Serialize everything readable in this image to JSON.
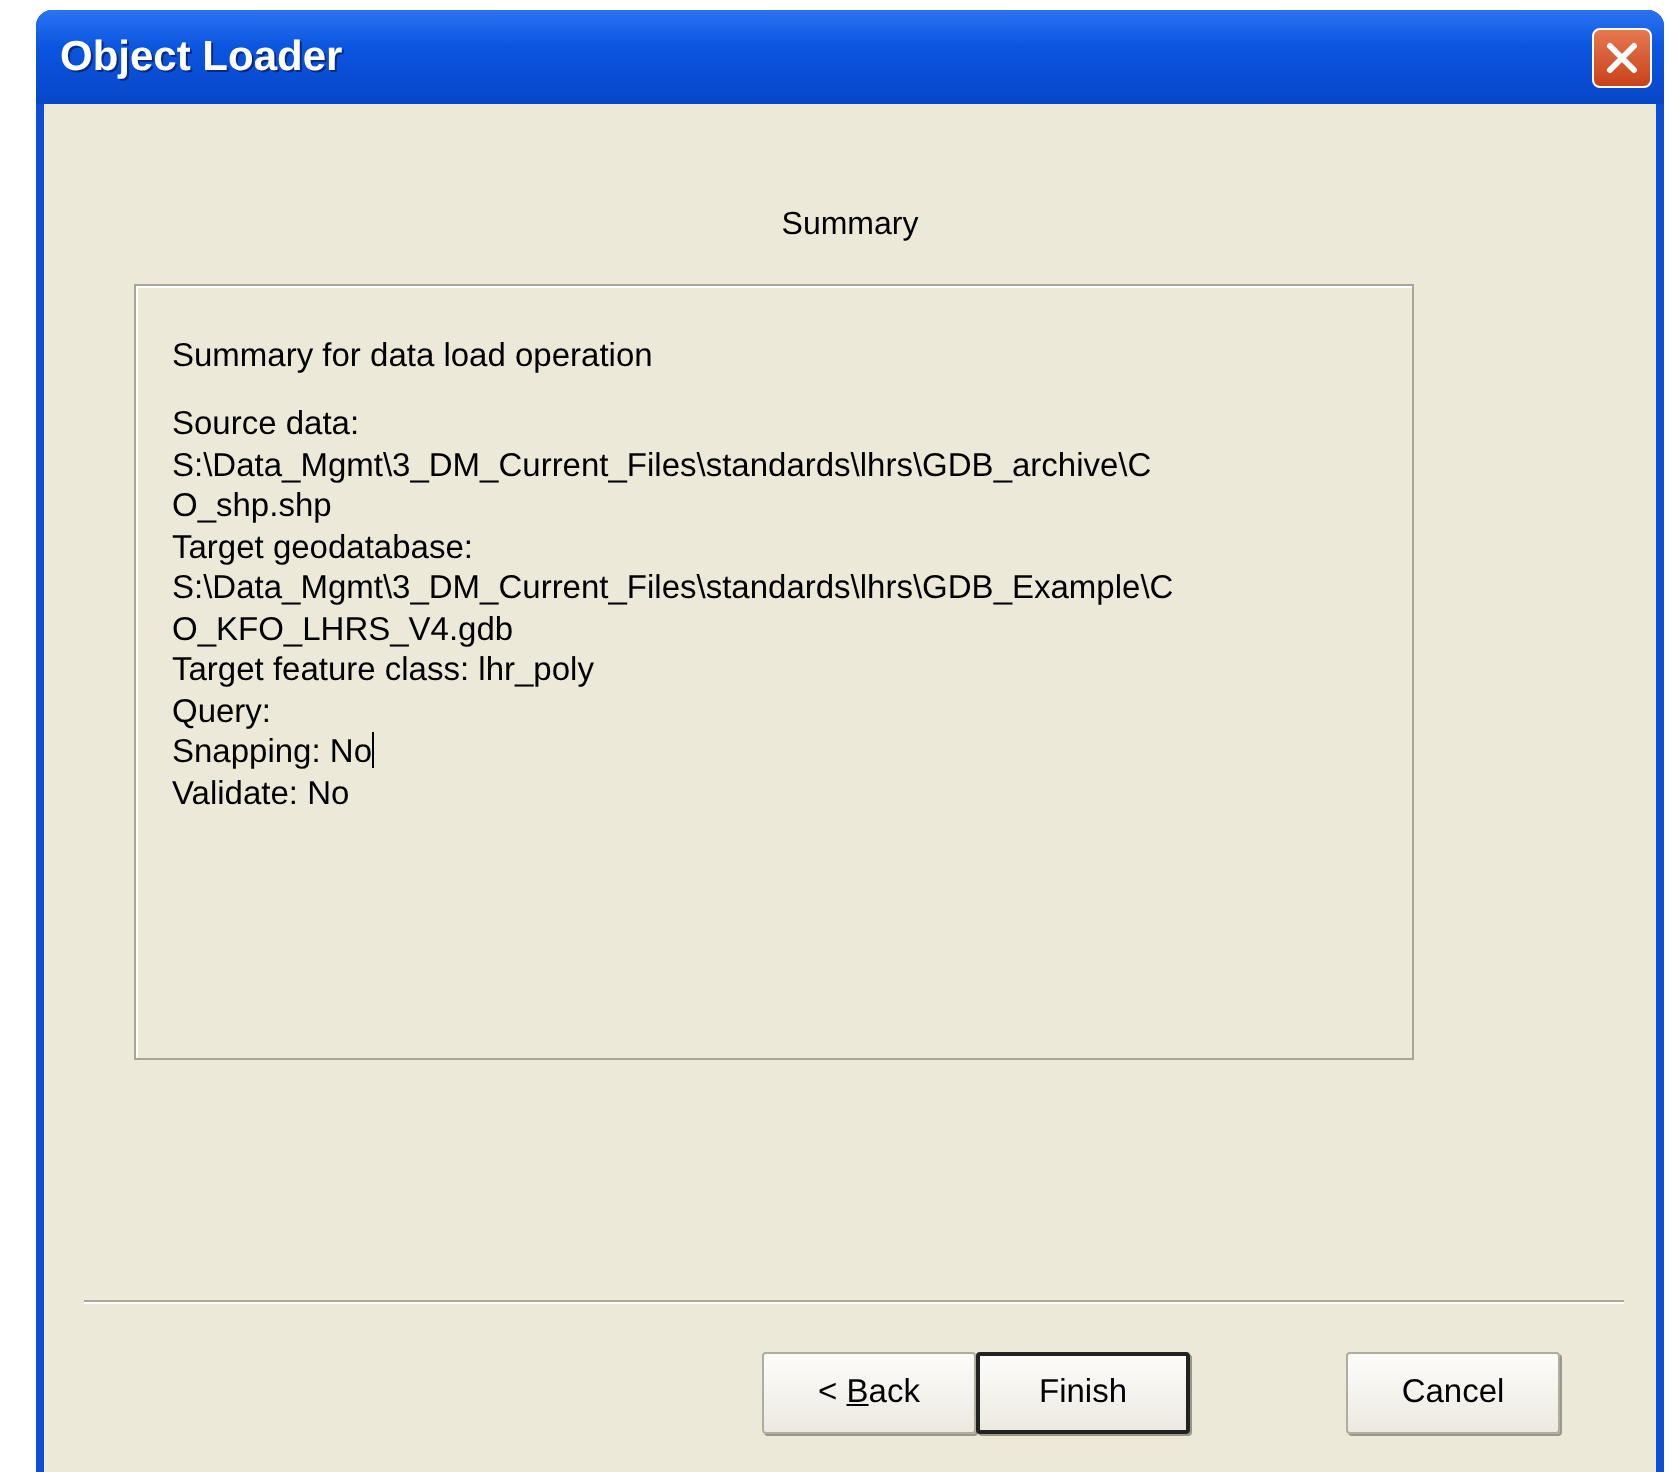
{
  "window": {
    "title": "Object Loader"
  },
  "heading": "Summary",
  "summary": {
    "title": "Summary for data load operation",
    "lines": [
      {
        "text": "Source data:",
        "caret": false
      },
      {
        "text": "S:\\Data_Mgmt\\3_DM_Current_Files\\standards\\lhrs\\GDB_archive\\C",
        "caret": false
      },
      {
        "text": "O_shp.shp",
        "caret": false
      },
      {
        "text": "Target geodatabase:",
        "caret": false
      },
      {
        "text": "S:\\Data_Mgmt\\3_DM_Current_Files\\standards\\lhrs\\GDB_Example\\C",
        "caret": false
      },
      {
        "text": "O_KFO_LHRS_V4.gdb",
        "caret": false
      },
      {
        "text": "Target feature class: lhr_poly",
        "caret": false
      },
      {
        "text": "Query:",
        "caret": false
      },
      {
        "text": "Snapping: No",
        "caret": true
      },
      {
        "text": "Validate: No",
        "caret": false
      }
    ]
  },
  "buttons": [
    {
      "label": {
        "before": "< ",
        "underlined": "B",
        "after": "ack"
      },
      "default": false
    },
    {
      "label": {
        "before": "Finish"
      },
      "default": true
    },
    {
      "label": {
        "before": "Cancel"
      },
      "default": false
    }
  ]
}
